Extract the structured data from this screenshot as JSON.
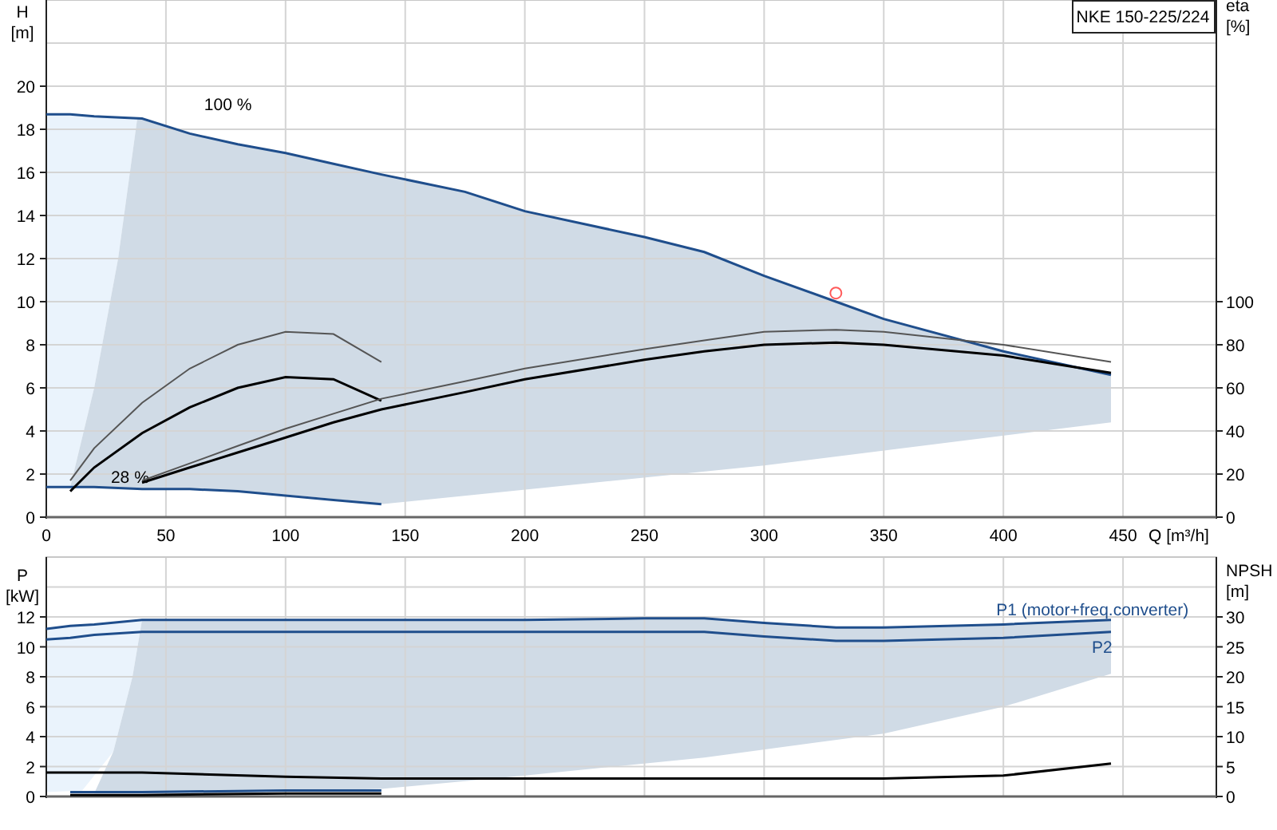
{
  "charts": [
    {
      "chart_data": {
        "type": "line",
        "title": "NKE 150-225/224",
        "xlabel": "Q [m³/h]",
        "ylabel": "H [m]",
        "y2label": "eta [%]",
        "x": [
          0,
          10,
          20,
          40,
          60,
          80,
          100,
          120,
          140,
          175,
          200,
          250,
          275,
          300,
          330,
          350,
          400,
          445
        ],
        "xlim": [
          0,
          489
        ],
        "ylim": [
          0,
          24
        ],
        "y2lim": [
          0,
          240
        ],
        "grid": true,
        "xticks": [
          0,
          50,
          100,
          150,
          200,
          250,
          300,
          350,
          400,
          450
        ],
        "yticks": [
          0,
          2,
          4,
          6,
          8,
          10,
          12,
          14,
          16,
          18,
          20
        ],
        "y2ticks": [
          0,
          20,
          40,
          60,
          80,
          100
        ],
        "series": [
          {
            "name": "100 %",
            "color": "#1f4e8c",
            "values": [
              18.7,
              18.7,
              18.6,
              18.5,
              17.8,
              17.3,
              16.9,
              16.4,
              15.9,
              15.1,
              14.2,
              13.0,
              12.3,
              11.2,
              10.0,
              9.2,
              7.7,
              6.6
            ]
          },
          {
            "name": "28 %",
            "color": "#1f4e8c",
            "values": [
              1.4,
              1.4,
              1.4,
              1.3,
              1.3,
              1.2,
              1.0,
              0.8,
              0.6,
              null,
              null,
              null,
              null,
              null,
              null,
              null,
              null,
              null
            ]
          },
          {
            "axis": "y2",
            "color": "#555555",
            "values": [
              null,
              17,
              32,
              53,
              69,
              80,
              86,
              85,
              72,
              null,
              null,
              null,
              null,
              null,
              null,
              null,
              null,
              null
            ]
          },
          {
            "axis": "y2",
            "color": "#000000",
            "values": [
              null,
              12,
              23,
              39,
              51,
              60,
              65,
              64,
              54,
              null,
              null,
              null,
              null,
              null,
              null,
              null,
              null,
              null
            ]
          },
          {
            "axis": "y2",
            "color": "#555555",
            "values": [
              null,
              null,
              null,
              17,
              25,
              33,
              41,
              48,
              55,
              63,
              69,
              78,
              82,
              86,
              87,
              86,
              80,
              72
            ]
          },
          {
            "axis": "y2",
            "color": "#000000",
            "values": [
              null,
              null,
              null,
              16,
              23,
              30,
              37,
              44,
              50,
              58,
              64,
              73,
              77,
              80,
              81,
              80,
              75,
              67
            ]
          },
          {
            "color": "#ff5a5a",
            "marker": "circle",
            "values": [
              null,
              null,
              null,
              null,
              null,
              null,
              null,
              null,
              null,
              null,
              null,
              null,
              null,
              null,
              10.4,
              null,
              null,
              null
            ]
          }
        ]
      }
    },
    {
      "chart_data": {
        "type": "line",
        "ylabel": "P [kW]",
        "y2label": "NPSH [m]",
        "x": [
          0,
          10,
          20,
          40,
          100,
          140,
          200,
          250,
          275,
          300,
          330,
          350,
          400,
          445
        ],
        "xlim": [
          0,
          489
        ],
        "ylim": [
          0,
          16
        ],
        "y2lim": [
          0,
          40
        ],
        "grid": true,
        "yticks": [
          0,
          2,
          4,
          6,
          8,
          10,
          12
        ],
        "y2ticks": [
          0,
          5,
          10,
          15,
          20,
          25,
          30
        ],
        "series": [
          {
            "name": "P1 (motor+freq.converter)",
            "color": "#1f4e8c",
            "values": [
              11.2,
              11.4,
              11.5,
              11.8,
              11.8,
              11.8,
              11.8,
              11.9,
              11.9,
              11.6,
              11.3,
              11.3,
              11.5,
              11.8
            ]
          },
          {
            "name": "P2",
            "color": "#1f4e8c",
            "values": [
              10.5,
              10.6,
              10.8,
              11.0,
              11.0,
              11.0,
              11.0,
              11.0,
              11.0,
              10.7,
              10.4,
              10.4,
              10.6,
              11.0
            ]
          },
          {
            "color": "#1f4e8c",
            "values": [
              null,
              0.3,
              0.3,
              0.3,
              0.4,
              0.4,
              null,
              null,
              null,
              null,
              null,
              null,
              null,
              null
            ]
          },
          {
            "color": "#000000",
            "values": [
              null,
              0.1,
              0.1,
              0.1,
              0.2,
              0.2,
              null,
              null,
              null,
              null,
              null,
              null,
              null,
              null
            ]
          },
          {
            "axis": "y2",
            "color": "#000000",
            "values": [
              4,
              4,
              4,
              4,
              3.3,
              3,
              3,
              3,
              3,
              3,
              3,
              3,
              3.5,
              5.5
            ]
          }
        ]
      }
    }
  ]
}
